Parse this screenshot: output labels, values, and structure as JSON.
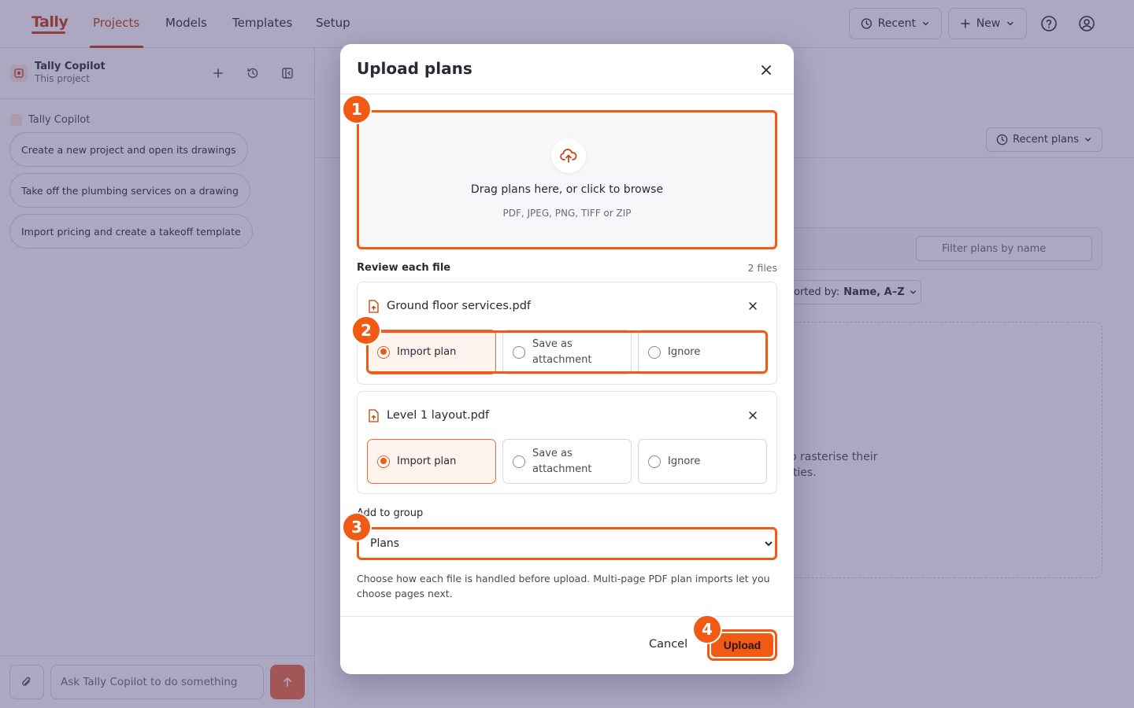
{
  "app": {
    "logo": "Tally",
    "nav": [
      {
        "label": "Projects",
        "active": true
      },
      {
        "label": "Models"
      },
      {
        "label": "Templates"
      },
      {
        "label": "Setup"
      }
    ],
    "recent_label": "Recent",
    "new_label": "New"
  },
  "sidebar": {
    "title": "Tally Copilot",
    "subtitle": "This project",
    "copilot_label": "Tally Copilot",
    "suggestions": [
      "Create a new project and open its drawings",
      "Take off the plumbing services on a drawing",
      "Import pricing and create a takeoff template"
    ],
    "input_placeholder": "Ask Tally Copilot to do something"
  },
  "background": {
    "recent_plans": "Recent plans",
    "filter_placeholder": "Filter plans by name",
    "sort_prefix": "orted by:",
    "sort_value": "Name, A–Z",
    "empty_line1": "o rasterise their",
    "empty_line2": "ities."
  },
  "modal": {
    "title": "Upload plans",
    "drop_main": "Drag plans here, or click to browse",
    "drop_sub": "PDF, JPEG, PNG, TIFF or ZIP",
    "review_label": "Review each file",
    "files_count": "2 files",
    "files": [
      {
        "name": "Ground floor services.pdf",
        "options": [
          "Import plan",
          "Save as attachment",
          "Ignore"
        ],
        "selected": "Import plan"
      },
      {
        "name": "Level 1 layout.pdf",
        "options": [
          "Import plan",
          "Save as attachment",
          "Ignore"
        ],
        "selected": "Import plan"
      }
    ],
    "group_label": "Add to group",
    "group_value": "Plans",
    "group_options": [
      "Plans"
    ],
    "help_text": "Choose how each file is handled before upload. Multi-page PDF plan imports let you choose pages next.",
    "cancel_label": "Cancel",
    "upload_label": "Upload"
  },
  "steps": [
    "1",
    "2",
    "3",
    "4"
  ],
  "colors": {
    "accent": "#f05a14",
    "brand": "#c2410c",
    "overlay": "#483e78"
  }
}
